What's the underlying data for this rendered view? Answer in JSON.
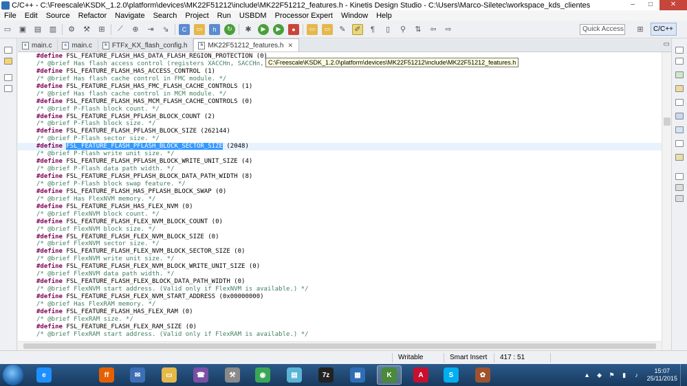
{
  "window": {
    "title": "C/C++ - C:\\Freescale\\KSDK_1.2.0\\platform\\devices\\MK22F51212\\include\\MK22F51212_features.h - Kinetis Design Studio - C:\\Users\\Marco-Siletec\\workspace_kds_clientes",
    "min": "–",
    "max": "□",
    "close": "✕"
  },
  "menu": [
    "File",
    "Edit",
    "Source",
    "Refactor",
    "Navigate",
    "Search",
    "Project",
    "Run",
    "USBDM",
    "Processor Expert",
    "Window",
    "Help"
  ],
  "toolbar": {
    "quick_access": "Quick Access",
    "perspective": "C/C++"
  },
  "tabs": [
    {
      "label": "main.c",
      "icon": "c-file-icon",
      "active": false
    },
    {
      "label": "main.c",
      "icon": "c-file-icon",
      "active": false
    },
    {
      "label": "FTFx_KX_flash_config.h",
      "icon": "h-file-icon",
      "active": false
    },
    {
      "label": "MK22F51212_features.h",
      "icon": "h-file-icon",
      "active": true,
      "close": "✕"
    }
  ],
  "tab_overflow": "▭",
  "tooltip": "C:\\Freescale\\KSDK_1.2.0\\platform\\devices\\MK22F51212\\include\\MK22F51212_features.h",
  "code_lines": [
    {
      "kw": "#define",
      "text": " FSL_FEATURE_FLASH_HAS_DATA_FLASH_REGION_PROTECTION (0)"
    },
    {
      "cm": "/* @brief Has flash access control (registers XACCHn, SACCHn, whe"
    },
    {
      "kw": "#define",
      "text": " FSL_FEATURE_FLASH_HAS_ACCESS_CONTROL (1)"
    },
    {
      "cm": "/* @brief Has flash cache control in FMC module. */"
    },
    {
      "kw": "#define",
      "text": " FSL_FEATURE_FLASH_HAS_FMC_FLASH_CACHE_CONTROLS (1)"
    },
    {
      "cm": "/* @brief Has flash cache control in MCM module. */"
    },
    {
      "kw": "#define",
      "text": " FSL_FEATURE_FLASH_HAS_MCM_FLASH_CACHE_CONTROLS (0)"
    },
    {
      "cm": "/* @brief P-Flash block count. */"
    },
    {
      "kw": "#define",
      "text": " FSL_FEATURE_FLASH_PFLASH_BLOCK_COUNT (2)"
    },
    {
      "cm": "/* @brief P-Flash block size. */"
    },
    {
      "kw": "#define",
      "text": " FSL_FEATURE_FLASH_PFLASH_BLOCK_SIZE (262144)"
    },
    {
      "cm": "/* @brief P-Flash sector size. */"
    },
    {
      "kw": "#define",
      "sel": "FSL_FEATURE_FLASH_PFLASH_BLOCK_SECTOR_SIZE",
      "text": " (2048)",
      "current": true
    },
    {
      "cm": "/* @brief P-Flash write unit size. */"
    },
    {
      "kw": "#define",
      "text": " FSL_FEATURE_FLASH_PFLASH_BLOCK_WRITE_UNIT_SIZE (4)"
    },
    {
      "cm": "/* @brief P-Flash data path width. */"
    },
    {
      "kw": "#define",
      "text": " FSL_FEATURE_FLASH_PFLASH_BLOCK_DATA_PATH_WIDTH (8)"
    },
    {
      "cm": "/* @brief P-Flash block swap feature. */"
    },
    {
      "kw": "#define",
      "text": " FSL_FEATURE_FLASH_HAS_PFLASH_BLOCK_SWAP (0)"
    },
    {
      "cm": "/* @brief Has FlexNVM memory. */"
    },
    {
      "kw": "#define",
      "text": " FSL_FEATURE_FLASH_HAS_FLEX_NVM (0)"
    },
    {
      "cm": "/* @brief FlexNVM block count. */"
    },
    {
      "kw": "#define",
      "text": " FSL_FEATURE_FLASH_FLEX_NVM_BLOCK_COUNT (0)"
    },
    {
      "cm": "/* @brief FlexNVM block size. */"
    },
    {
      "kw": "#define",
      "text": " FSL_FEATURE_FLASH_FLEX_NVM_BLOCK_SIZE (0)"
    },
    {
      "cm": "/* @brief FlexNVM sector size. */"
    },
    {
      "kw": "#define",
      "text": " FSL_FEATURE_FLASH_FLEX_NVM_BLOCK_SECTOR_SIZE (0)"
    },
    {
      "cm": "/* @brief FlexNVM write unit size. */"
    },
    {
      "kw": "#define",
      "text": " FSL_FEATURE_FLASH_FLEX_NVM_BLOCK_WRITE_UNIT_SIZE (0)"
    },
    {
      "cm": "/* @brief FlexNVM data path width. */"
    },
    {
      "kw": "#define",
      "text": " FSL_FEATURE_FLASH_FLEX_BLOCK_DATA_PATH_WIDTH (0)"
    },
    {
      "cm": "/* @brief FlexNVM start address. (Valid only if FlexNVM is available.) */"
    },
    {
      "kw": "#define",
      "text": " FSL_FEATURE_FLASH_FLEX_NVM_START_ADDRESS (0x00000000)"
    },
    {
      "cm": "/* @brief Has FlexRAM memory. */"
    },
    {
      "kw": "#define",
      "text": " FSL_FEATURE_FLASH_HAS_FLEX_RAM (0)"
    },
    {
      "cm": "/* @brief FlexRAM size. */"
    },
    {
      "kw": "#define",
      "text": " FSL_FEATURE_FLASH_FLEX_RAM_SIZE (0)"
    },
    {
      "cm": "/* @brief FlexRAM start address. (Valid only if FlexRAM is available.) */"
    }
  ],
  "status": {
    "mode": "Writable",
    "insert": "Smart Insert",
    "position": "417 : 51"
  },
  "taskbar": {
    "apps": [
      {
        "name": "ie-icon",
        "color": "#1e90ff",
        "glyph": "e"
      },
      {
        "name": "firefox-icon",
        "color": "#e66000",
        "glyph": "ff"
      },
      {
        "name": "thunderbird-icon",
        "color": "#3d6fb6",
        "glyph": "✉"
      },
      {
        "name": "explorer-icon",
        "color": "#e6b84a",
        "glyph": "▭"
      },
      {
        "name": "viber-icon",
        "color": "#7b4fa3",
        "glyph": "☎"
      },
      {
        "name": "tools-icon",
        "color": "#8a8a8a",
        "glyph": "⚒"
      },
      {
        "name": "chrome-icon",
        "color": "#3aa757",
        "glyph": "◉"
      },
      {
        "name": "notes-icon",
        "color": "#5ab4d6",
        "glyph": "▤"
      },
      {
        "name": "7zip-icon",
        "color": "#222222",
        "glyph": "7z"
      },
      {
        "name": "app-icon",
        "color": "#2f6db5",
        "glyph": "▦"
      },
      {
        "name": "kds-icon",
        "color": "#4a8a3a",
        "glyph": "K"
      },
      {
        "name": "acrobat-icon",
        "color": "#c8102e",
        "glyph": "A"
      },
      {
        "name": "skype-icon",
        "color": "#00aff0",
        "glyph": "S"
      },
      {
        "name": "photo-icon",
        "color": "#a0522d",
        "glyph": "✿"
      }
    ],
    "time": "15:07",
    "date": "25/11/2015"
  }
}
